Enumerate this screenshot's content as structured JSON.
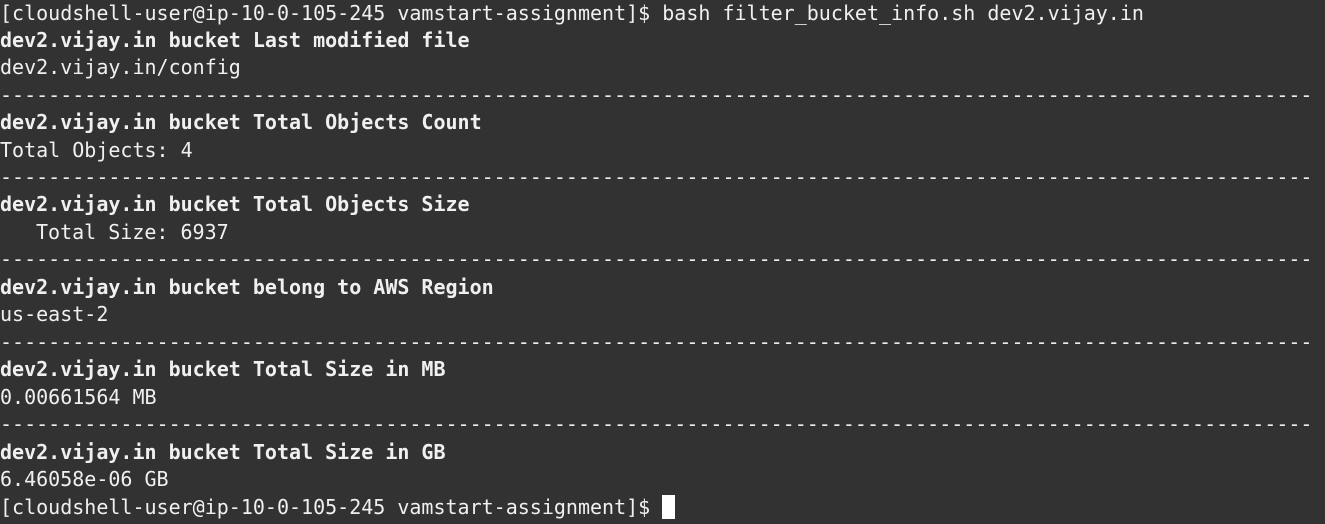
{
  "terminal": {
    "command_line": "[cloudshell-user@ip-10-0-105-245 vamstart-assignment]$ bash filter_bucket_info.sh dev2.vijay.in",
    "sections": [
      {
        "heading": "dev2.vijay.in bucket Last modified file",
        "value": "dev2.vijay.in/config"
      },
      {
        "heading": "dev2.vijay.in bucket Total Objects Count",
        "value": "Total Objects: 4"
      },
      {
        "heading": "dev2.vijay.in bucket Total Objects Size",
        "value": "Total Size: 6937"
      },
      {
        "heading": "dev2.vijay.in bucket belong to AWS Region",
        "value": "us-east-2"
      },
      {
        "heading": "dev2.vijay.in bucket Total Size in MB",
        "value": "0.00661564 MB"
      },
      {
        "heading": "dev2.vijay.in bucket Total Size in GB",
        "value": "6.46058e-06 GB"
      }
    ],
    "separator": "----------------------------------------------------------------------------------------------------------------------------------------------------------------",
    "prompt": "[cloudshell-user@ip-10-0-105-245 vamstart-assignment]$ "
  }
}
